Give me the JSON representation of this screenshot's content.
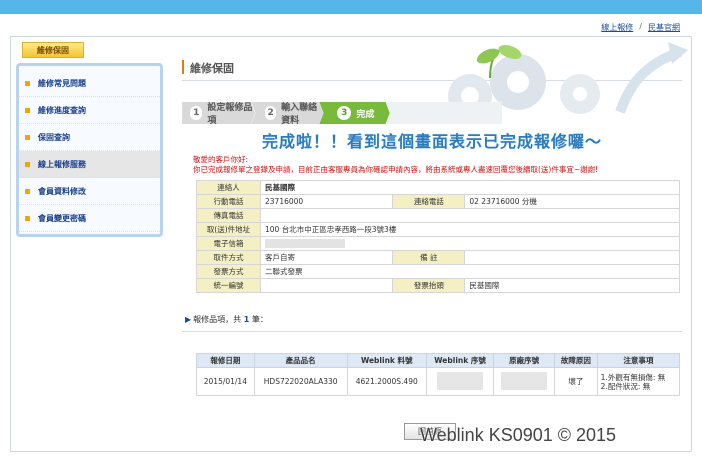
{
  "top_links": {
    "online_repair": "線上報修",
    "site": "民基官網",
    "separator": "/"
  },
  "sidebar": {
    "tab_label": "維修保固",
    "items": [
      {
        "label": "維修常見問題"
      },
      {
        "label": "維修進度查詢"
      },
      {
        "label": "保固查詢"
      },
      {
        "label": "線上報修服務"
      },
      {
        "label": "會員資料修改"
      },
      {
        "label": "會員變更密碼"
      }
    ]
  },
  "page_title": "維修保固",
  "steps": [
    {
      "num": "1",
      "label": "設定報修品項"
    },
    {
      "num": "2",
      "label": "輸入聯絡資料"
    },
    {
      "num": "3",
      "label": "完成"
    }
  ],
  "banner": "完成啦！！看到這個畫面表示已完成報修囉～",
  "notice": {
    "line1": "敬愛的客戶你好:",
    "line2": "你已完成報修單之登錄及申請，目前正由客服專員為你確認申請內容，將由系統或專人盡速回覆您後續取(送)件事宜~謝謝!"
  },
  "info": {
    "contact_label": "連絡人",
    "contact_value": "民基國際",
    "mobile_label": "行動電話",
    "mobile_value": "23716000",
    "phone_label": "連絡電話",
    "phone_value": "02 23716000 分機",
    "fax_label": "傳真電話",
    "fax_value": "",
    "address_label": "取(送)件地址",
    "address_value": "100 台北市中正區忠孝西路一段3號3樓",
    "email_label": "電子信箱",
    "pickup_label": "取件方式",
    "pickup_value": "客戶自寄",
    "remark_label": "備 註",
    "remark_value": "",
    "invoice_label": "發票方式",
    "invoice_value": "二聯式發票",
    "taxid_label": "統一編號",
    "taxid_value": "",
    "invoice_title_label": "發票抬頭",
    "invoice_title_value": "民基國際"
  },
  "items_label": {
    "prefix": "報修品項，共",
    "count": "1",
    "suffix": "筆："
  },
  "products": {
    "headers": [
      "報修日期",
      "產品品名",
      "Weblink 料號",
      "Weblink 序號",
      "原廠序號",
      "故障原因",
      "注意事項"
    ],
    "rows": [
      {
        "date": "2015/01/14",
        "name": "HDS722020ALA330",
        "part": "4621.2000S.490",
        "reason": "壞了",
        "note1": "1.外觀有無損傷: 無",
        "note2": "2.配件狀況: 無"
      }
    ]
  },
  "back_button": "回首頁",
  "watermark": "Weblink KS0901 © 2015",
  "colors": {
    "accent_green": "#79b93b",
    "top_blue": "#55b6ea",
    "link_blue": "#1a4d99",
    "notice_red": "#cc1111"
  }
}
